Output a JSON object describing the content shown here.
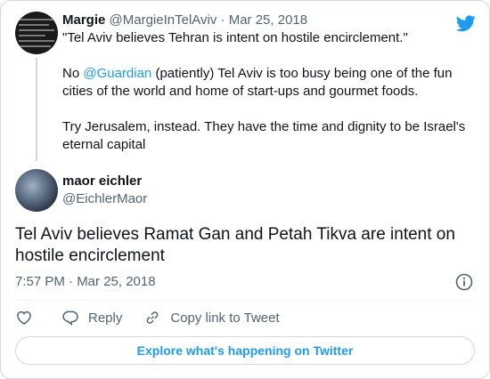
{
  "colors": {
    "accent": "#1d9bf0",
    "text_primary": "#0f1419",
    "text_secondary": "#536471",
    "border": "#cfd9de"
  },
  "header": {
    "logo_icon": "twitter-bird-icon"
  },
  "parent_tweet": {
    "author_name": "Margie",
    "author_handle": "@MargieInTelAviv",
    "separator": "·",
    "date": "Mar 25, 2018",
    "line1": "\"Tel Aviv believes Tehran is intent on hostile encirclement.\"",
    "line2_prefix": "No ",
    "line2_mention": "@Guardian",
    "line2_suffix": " (patiently) Tel Aviv is too busy being one of the fun cities of the world and home of start-ups and gourmet foods.",
    "line3": "Try Jerusalem, instead. They have the time and dignity to be Israel's eternal capital"
  },
  "main_tweet": {
    "author_name": "maor eichler",
    "author_handle": "@EichlerMaor",
    "text": "Tel Aviv believes Ramat Gan and Petah Tikva are intent on hostile encirclement",
    "timestamp": "7:57 PM · Mar 25, 2018",
    "info_icon": "info-icon"
  },
  "actions": {
    "like_icon": "heart-icon",
    "reply_label": "Reply",
    "reply_icon": "reply-bubble-icon",
    "copy_label": "Copy link to Tweet",
    "copy_icon": "link-icon"
  },
  "footer": {
    "explore_label": "Explore what's happening on Twitter"
  }
}
